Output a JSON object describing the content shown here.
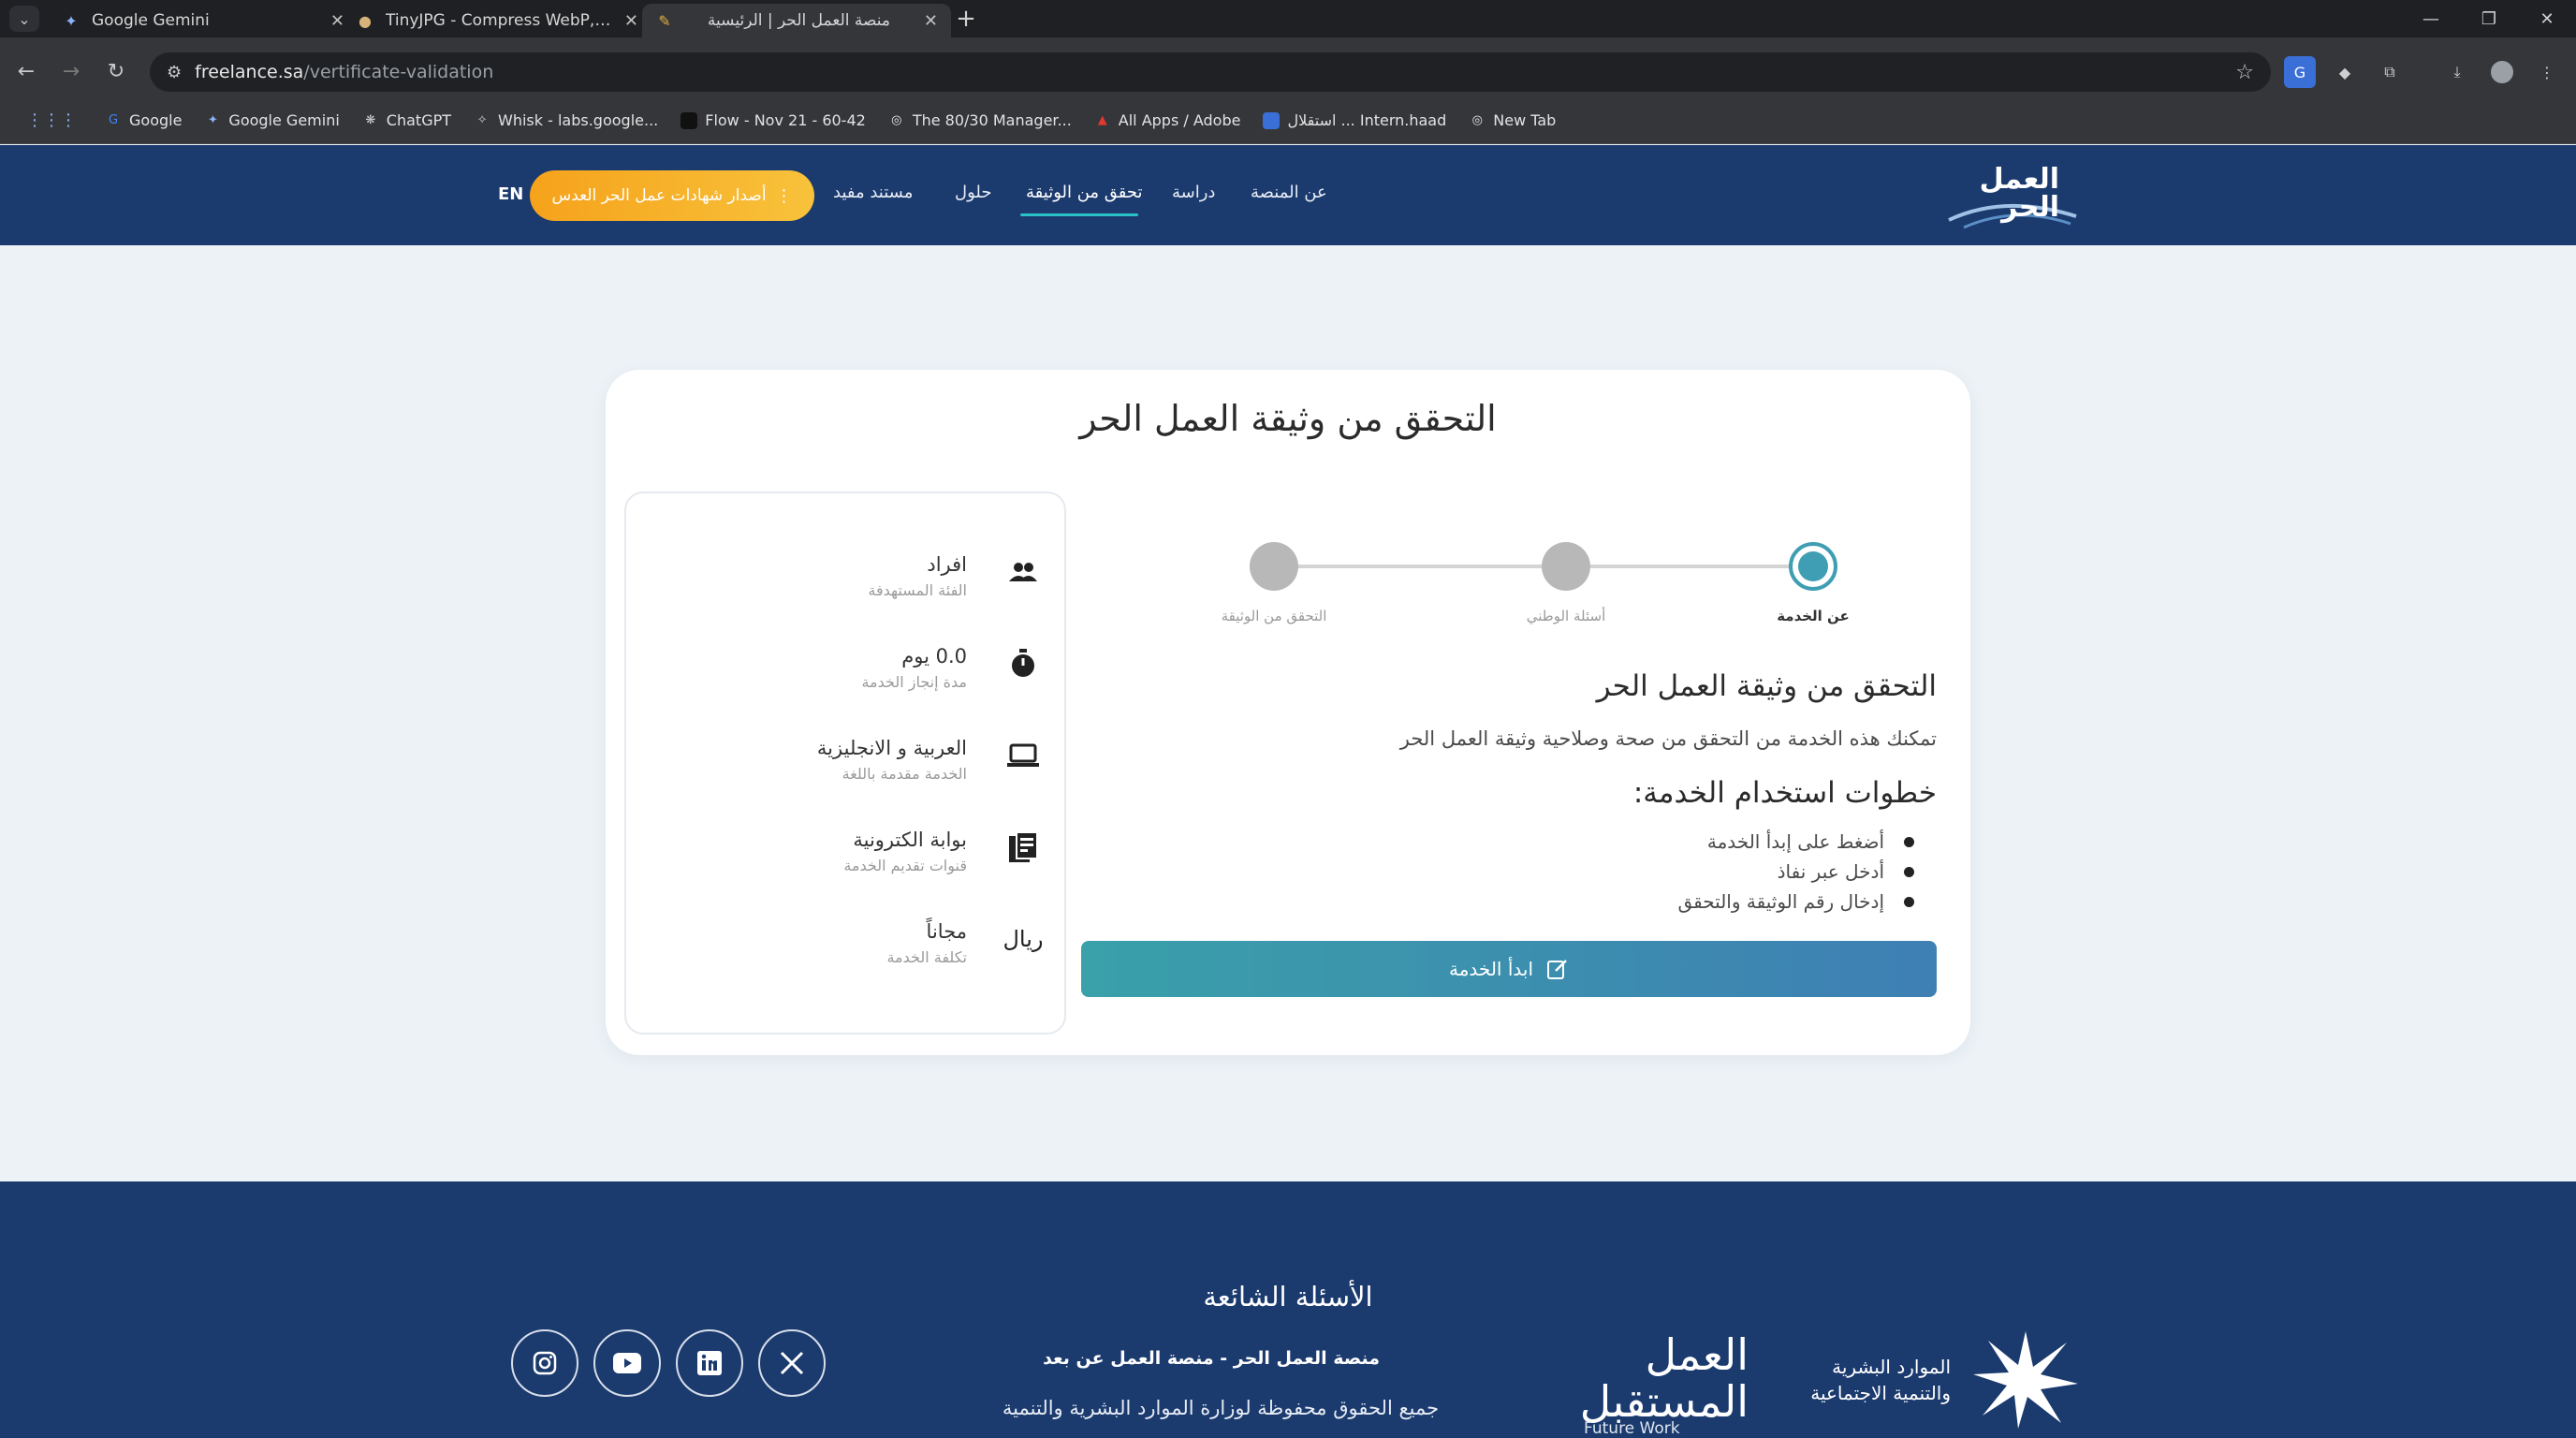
{
  "browser": {
    "tabs": [
      {
        "title": "Google Gemini",
        "favicon": "gemini-icon"
      },
      {
        "title": "TinyJPG - Compress WebP, PNG and JPEG",
        "favicon": "tinyjpg-icon"
      },
      {
        "title": "منصة العمل الحر | الرئيسية",
        "favicon": "freelance-icon"
      }
    ],
    "url_host": "freelance.sa",
    "url_path": "/vertificate-validation",
    "bookmarks": [
      {
        "label": "Google",
        "icon": "google-icon",
        "color": "#4285f4"
      },
      {
        "label": "Google Gemini",
        "icon": "gemini-icon",
        "color": "#8ab4f8"
      },
      {
        "label": "ChatGPT",
        "icon": "chatgpt-icon",
        "color": "#bdbdbd"
      },
      {
        "label": "Whisk - labs.google...",
        "icon": "whisk-icon",
        "color": "#c7c7c7"
      },
      {
        "label": "Flow - Nov 21 - 60-42",
        "icon": "flow-icon",
        "color": "#111111"
      },
      {
        "label": "The 80/30 Manager...",
        "icon": "globe-icon",
        "color": "#e8e8e8"
      },
      {
        "label": "All Apps / Adobe",
        "icon": "adobe-icon",
        "color": "#e03a2f"
      },
      {
        "label": "استقلال ... Intern.haad",
        "icon": "app-icon",
        "color": "#3b6fd8"
      },
      {
        "label": "New Tab",
        "icon": "globe-icon",
        "color": "#e8e8e8"
      }
    ]
  },
  "site": {
    "logo_text": "العمل الحر",
    "nav": [
      {
        "label": "عن المنصة"
      },
      {
        "label": "دراسة"
      },
      {
        "label": "تحقق من الوثيقة",
        "active": true
      },
      {
        "label": "حلول"
      },
      {
        "label": "مستند مفيد"
      }
    ],
    "cta_label": "أصدار شهادات عمل الحر العدس",
    "lang": "EN"
  },
  "card": {
    "title": "التحقق من وثيقة العمل الحر",
    "info_rows": [
      {
        "icon": "users-icon",
        "main": "افراد",
        "sub": "الفئة المستهدفة"
      },
      {
        "icon": "stopwatch-icon",
        "main": "0.0 يوم",
        "sub": "مدة إنجاز الخدمة"
      },
      {
        "icon": "laptop-icon",
        "main": "العربية و الانجليزية",
        "sub": "الخدمة مقدمة باللغة"
      },
      {
        "icon": "portal-icon",
        "main": "بوابة الكترونية",
        "sub": "قنوات تقديم الخدمة"
      },
      {
        "icon": "riyal-icon",
        "icon_text": "ريال",
        "main": "مجاناً",
        "sub": "تكلفة الخدمة"
      }
    ],
    "steps": [
      {
        "label": "عن الخدمة",
        "active": true
      },
      {
        "label": "أسئلة الوطني",
        "active": false
      },
      {
        "label": "التحقق من الوثيقة",
        "active": false
      }
    ],
    "desc_title": "التحقق من وثيقة العمل الحر",
    "desc_text": "تمكنك هذه الخدمة من التحقق من صحة وصلاحية وثيقة العمل الحر",
    "steps_title": "خطوات استخدام الخدمة:",
    "steps_list": [
      "أضغط على إبدأ الخدمة",
      "أدخل عبر نفاذ",
      "إدخال رقم الوثيقة والتحقق"
    ],
    "start_button": "ابدأ الخدمة"
  },
  "footer": {
    "faq": "الأسئلة الشائعة",
    "line1": "منصة العمل الحر - منصة العمل عن بعد",
    "line2": "جميع الحقوق محفوظة لوزارة الموارد البشرية والتنمية",
    "future_work_ar": "العمل المستقبل",
    "future_work_en": "Future Work",
    "hr_line1": "الموارد البشرية",
    "hr_line2": "والتنمية الاجتماعية",
    "social": [
      "instagram-icon",
      "youtube-icon",
      "linkedin-icon",
      "x-icon"
    ]
  },
  "colors": {
    "header_bg": "#1b3a6e",
    "accent_teal": "#3f9eb3",
    "cta_orange": "#f6a21b"
  }
}
